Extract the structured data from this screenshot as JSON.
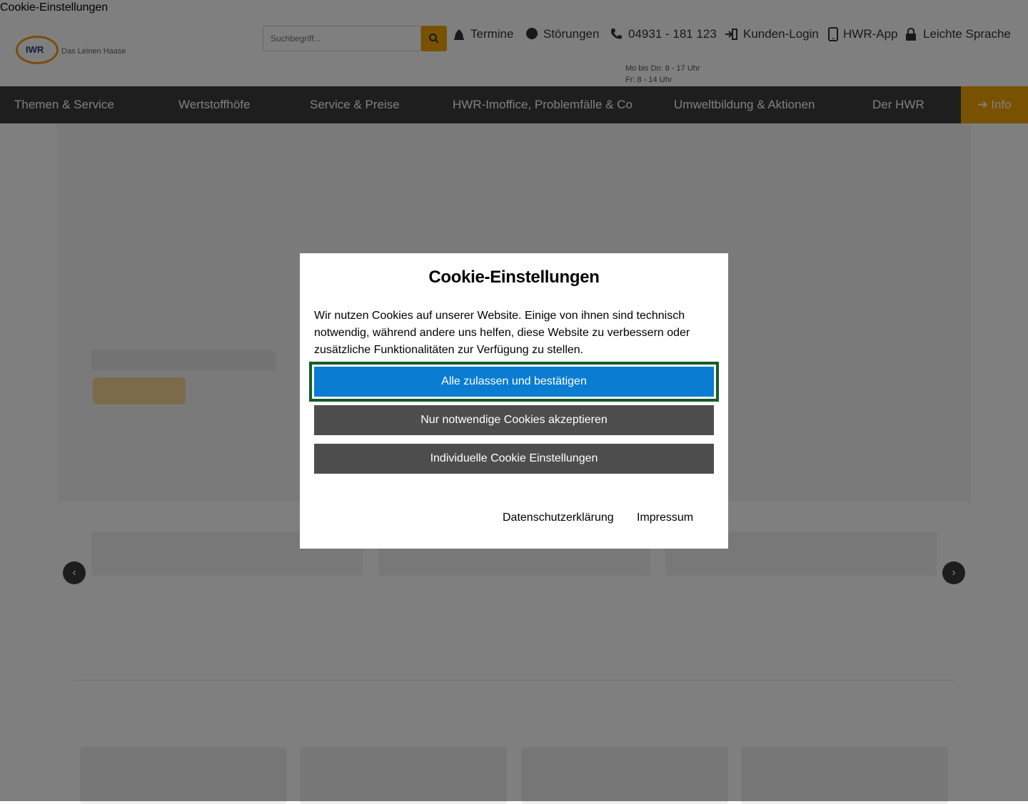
{
  "document_title": "Cookie-Einstellungen",
  "header": {
    "logo_text": "IWR",
    "logo_tagline": "Das Leinen Haase",
    "search_placeholder": "Suchbegriff...",
    "meta": [
      {
        "icon": "clock-icon",
        "label": "Termine"
      },
      {
        "icon": "map-pin-icon",
        "label": "Störungen"
      },
      {
        "icon": "phone-icon",
        "label": "04931 - 181 123"
      },
      {
        "icon": "login-icon",
        "label": "Kunden-Login"
      },
      {
        "icon": "smartphone-icon",
        "label": "HWR-App"
      },
      {
        "icon": "lock-icon",
        "label": "Leichte Sprache"
      }
    ],
    "phone_hours": [
      "Mo bis Do: 8 - 17 Uhr",
      "Fr: 8 - 14 Uhr"
    ]
  },
  "nav": {
    "items": [
      "Themen & Service",
      "Wertstoffhöfe",
      "Service & Preise",
      "HWR-Imoffice, Problemfälle & Co",
      "Umweltbildung & Aktionen",
      "Der HWR"
    ],
    "cta": "Info"
  },
  "cookie_modal": {
    "title": "Cookie-Einstellungen",
    "text": "Wir nutzen Cookies auf unserer Website. Einige von ihnen sind technisch notwendig, während andere uns helfen, diese Website zu verbessern oder zusätzliche Funktionalitäten zur Verfügung zu stellen.",
    "accept_all": "Alle zulassen und bestätigen",
    "necessary_only": "Nur notwendige Cookies akzeptieren",
    "individual": "Individuelle Cookie Einstellungen",
    "privacy_link": "Datenschutzerklärung",
    "imprint_link": "Impressum"
  },
  "colors": {
    "accent": "#f0a500",
    "primary_button": "#0a7cd2",
    "secondary_button": "#4d4d4d",
    "nav_background": "#3c3c3c",
    "focus_outline": "#135c2b"
  }
}
